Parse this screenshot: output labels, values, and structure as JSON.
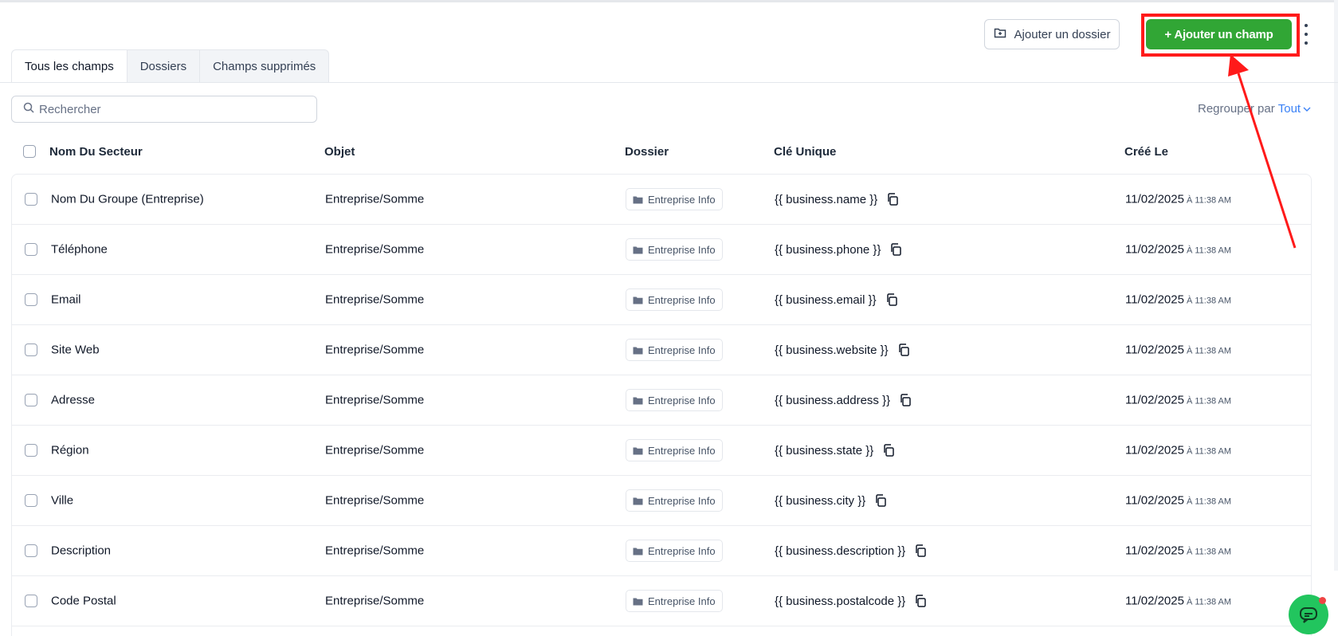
{
  "toolbar": {
    "add_folder_label": "Ajouter un dossier",
    "add_field_label": "+ Ajouter un champ"
  },
  "tabs": [
    {
      "label": "Tous les champs",
      "active": true
    },
    {
      "label": "Dossiers",
      "active": false
    },
    {
      "label": "Champs supprimés",
      "active": false
    }
  ],
  "search": {
    "placeholder": "Rechercher"
  },
  "group_by": {
    "label": "Regrouper par",
    "value": "Tout"
  },
  "table": {
    "headers": {
      "name": "Nom Du Secteur",
      "object": "Objet",
      "folder": "Dossier",
      "key": "Clé Unique",
      "created": "Créé Le"
    },
    "rows": [
      {
        "name": "Nom Du Groupe (Entreprise)",
        "object": "Entreprise/Somme",
        "folder": "Entreprise Info",
        "key": "{{ business.name }}",
        "date": "11/02/2025",
        "time": "À 11:38 AM"
      },
      {
        "name": "Téléphone",
        "object": "Entreprise/Somme",
        "folder": "Entreprise Info",
        "key": "{{ business.phone }}",
        "date": "11/02/2025",
        "time": "À 11:38 AM"
      },
      {
        "name": "Email",
        "object": "Entreprise/Somme",
        "folder": "Entreprise Info",
        "key": "{{ business.email }}",
        "date": "11/02/2025",
        "time": "À 11:38 AM"
      },
      {
        "name": "Site Web",
        "object": "Entreprise/Somme",
        "folder": "Entreprise Info",
        "key": "{{ business.website }}",
        "date": "11/02/2025",
        "time": "À 11:38 AM"
      },
      {
        "name": "Adresse",
        "object": "Entreprise/Somme",
        "folder": "Entreprise Info",
        "key": "{{ business.address }}",
        "date": "11/02/2025",
        "time": "À 11:38 AM"
      },
      {
        "name": "Région",
        "object": "Entreprise/Somme",
        "folder": "Entreprise Info",
        "key": "{{ business.state }}",
        "date": "11/02/2025",
        "time": "À 11:38 AM"
      },
      {
        "name": "Ville",
        "object": "Entreprise/Somme",
        "folder": "Entreprise Info",
        "key": "{{ business.city }}",
        "date": "11/02/2025",
        "time": "À 11:38 AM"
      },
      {
        "name": "Description",
        "object": "Entreprise/Somme",
        "folder": "Entreprise Info",
        "key": "{{ business.description }}",
        "date": "11/02/2025",
        "time": "À 11:38 AM"
      },
      {
        "name": "Code Postal",
        "object": "Entreprise/Somme",
        "folder": "Entreprise Info",
        "key": "{{ business.postalcode }}",
        "date": "11/02/2025",
        "time": "À 11:38 AM"
      }
    ]
  },
  "colors": {
    "primary_button": "#31a635",
    "highlight": "#ff1a1a",
    "link": "#3b82f6",
    "chat_bubble": "#22c55e"
  },
  "icons": [
    "folder-plus-icon",
    "kebab-menu-icon",
    "search-icon",
    "chevron-down-icon",
    "folder-icon",
    "copy-icon",
    "chat-icon"
  ]
}
